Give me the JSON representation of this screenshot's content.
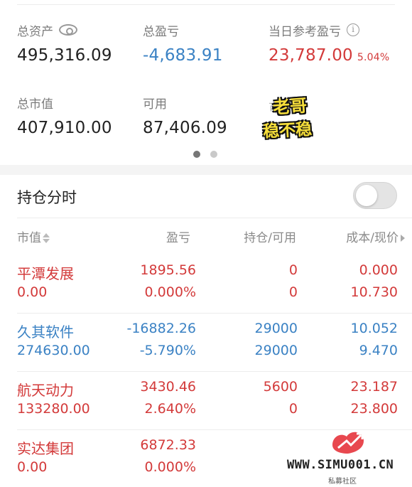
{
  "summary": {
    "total_assets": {
      "label": "总资产",
      "value": "495,316.09"
    },
    "total_pl": {
      "label": "总盈亏",
      "value": "-4,683.91"
    },
    "today_pl": {
      "label": "当日参考盈亏",
      "value": "23,787.00",
      "pct": "5.04%"
    },
    "market_value": {
      "label": "总市值",
      "value": "407,910.00"
    },
    "available": {
      "label": "可用",
      "value": "87,406.09"
    },
    "hidden_label": "可"
  },
  "sticker": {
    "line1": "老哥",
    "line2": "稳不稳"
  },
  "carousel": {
    "pages": 2,
    "active": 0
  },
  "positions_panel": {
    "title": "持仓分时",
    "toggle_on": false,
    "headers": {
      "market_value": "市值",
      "pl": "盈亏",
      "hold": "持仓/可用",
      "cost": "成本/现价"
    },
    "rows": [
      {
        "name": "平潭发展",
        "market_value": "0.00",
        "pl": "1895.56",
        "pl_pct": "0.000%",
        "hold": "0",
        "avail": "0",
        "cost": "0.000",
        "price": "10.730",
        "color": "red"
      },
      {
        "name": "久其软件",
        "market_value": "274630.00",
        "pl": "-16882.26",
        "pl_pct": "-5.790%",
        "hold": "29000",
        "avail": "29000",
        "cost": "10.052",
        "price": "9.470",
        "color": "blue"
      },
      {
        "name": "航天动力",
        "market_value": "133280.00",
        "pl": "3430.46",
        "pl_pct": "2.640%",
        "hold": "5600",
        "avail": "0",
        "cost": "23.187",
        "price": "23.800",
        "color": "red"
      },
      {
        "name": "实达集团",
        "market_value": "0.00",
        "pl": "6872.33",
        "pl_pct": "0.000%",
        "hold": "",
        "avail": "",
        "cost": "",
        "price": "",
        "color": "red"
      }
    ]
  },
  "watermark": {
    "text": "WWW.SIMU001.CN",
    "sub": "私募社区"
  },
  "colors": {
    "gain": "#d33a3a",
    "loss": "#3b82c4"
  }
}
